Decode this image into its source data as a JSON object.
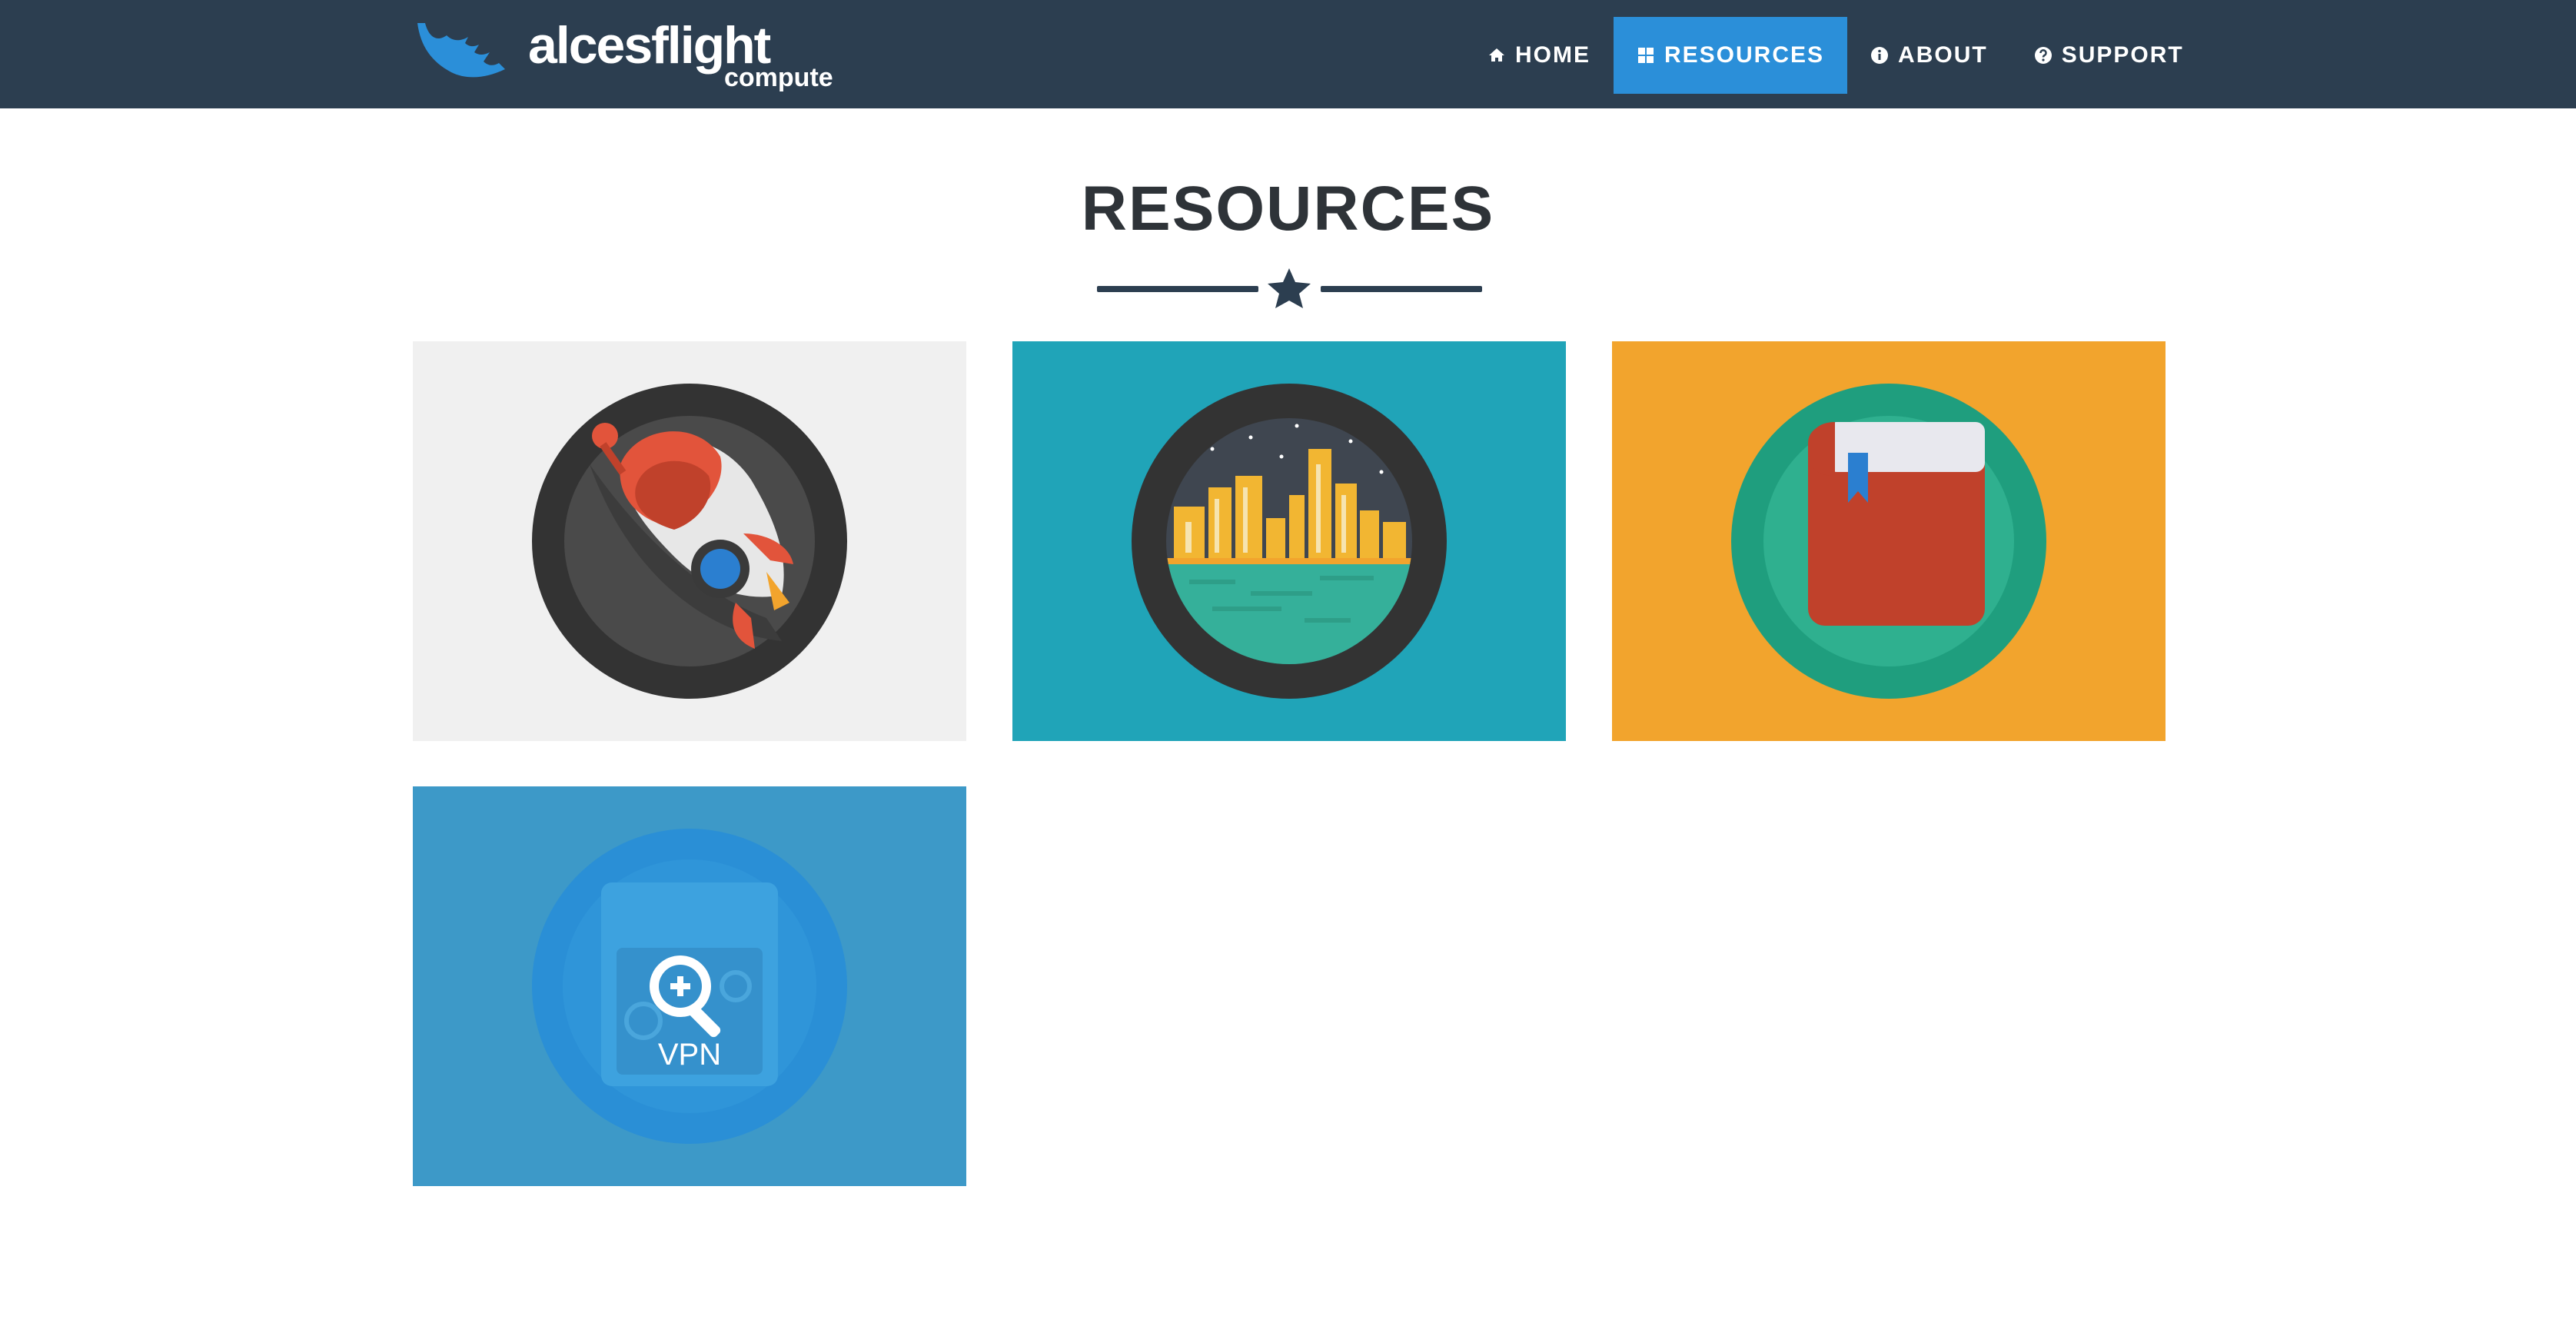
{
  "brand": {
    "name": "alcesflight",
    "product": "compute",
    "accent_color": "#2b8fd9"
  },
  "nav": {
    "items": [
      {
        "label": "HOME",
        "icon": "home-icon",
        "active": false
      },
      {
        "label": "RESOURCES",
        "icon": "grid-icon",
        "active": true
      },
      {
        "label": "ABOUT",
        "icon": "info-icon",
        "active": false
      },
      {
        "label": "SUPPORT",
        "icon": "question-icon",
        "active": false
      }
    ],
    "background": "#2c3e50"
  },
  "page": {
    "title": "RESOURCES",
    "divider_icon": "star-icon"
  },
  "tiles": [
    {
      "icon": "rocket-icon",
      "background": "#f0f0f0"
    },
    {
      "icon": "city-skyline-icon",
      "background": "#20a4b8"
    },
    {
      "icon": "book-icon",
      "background": "#f2a42d"
    },
    {
      "icon": "vpn-search-icon",
      "background": "#3d99c8",
      "label": "VPN"
    }
  ]
}
